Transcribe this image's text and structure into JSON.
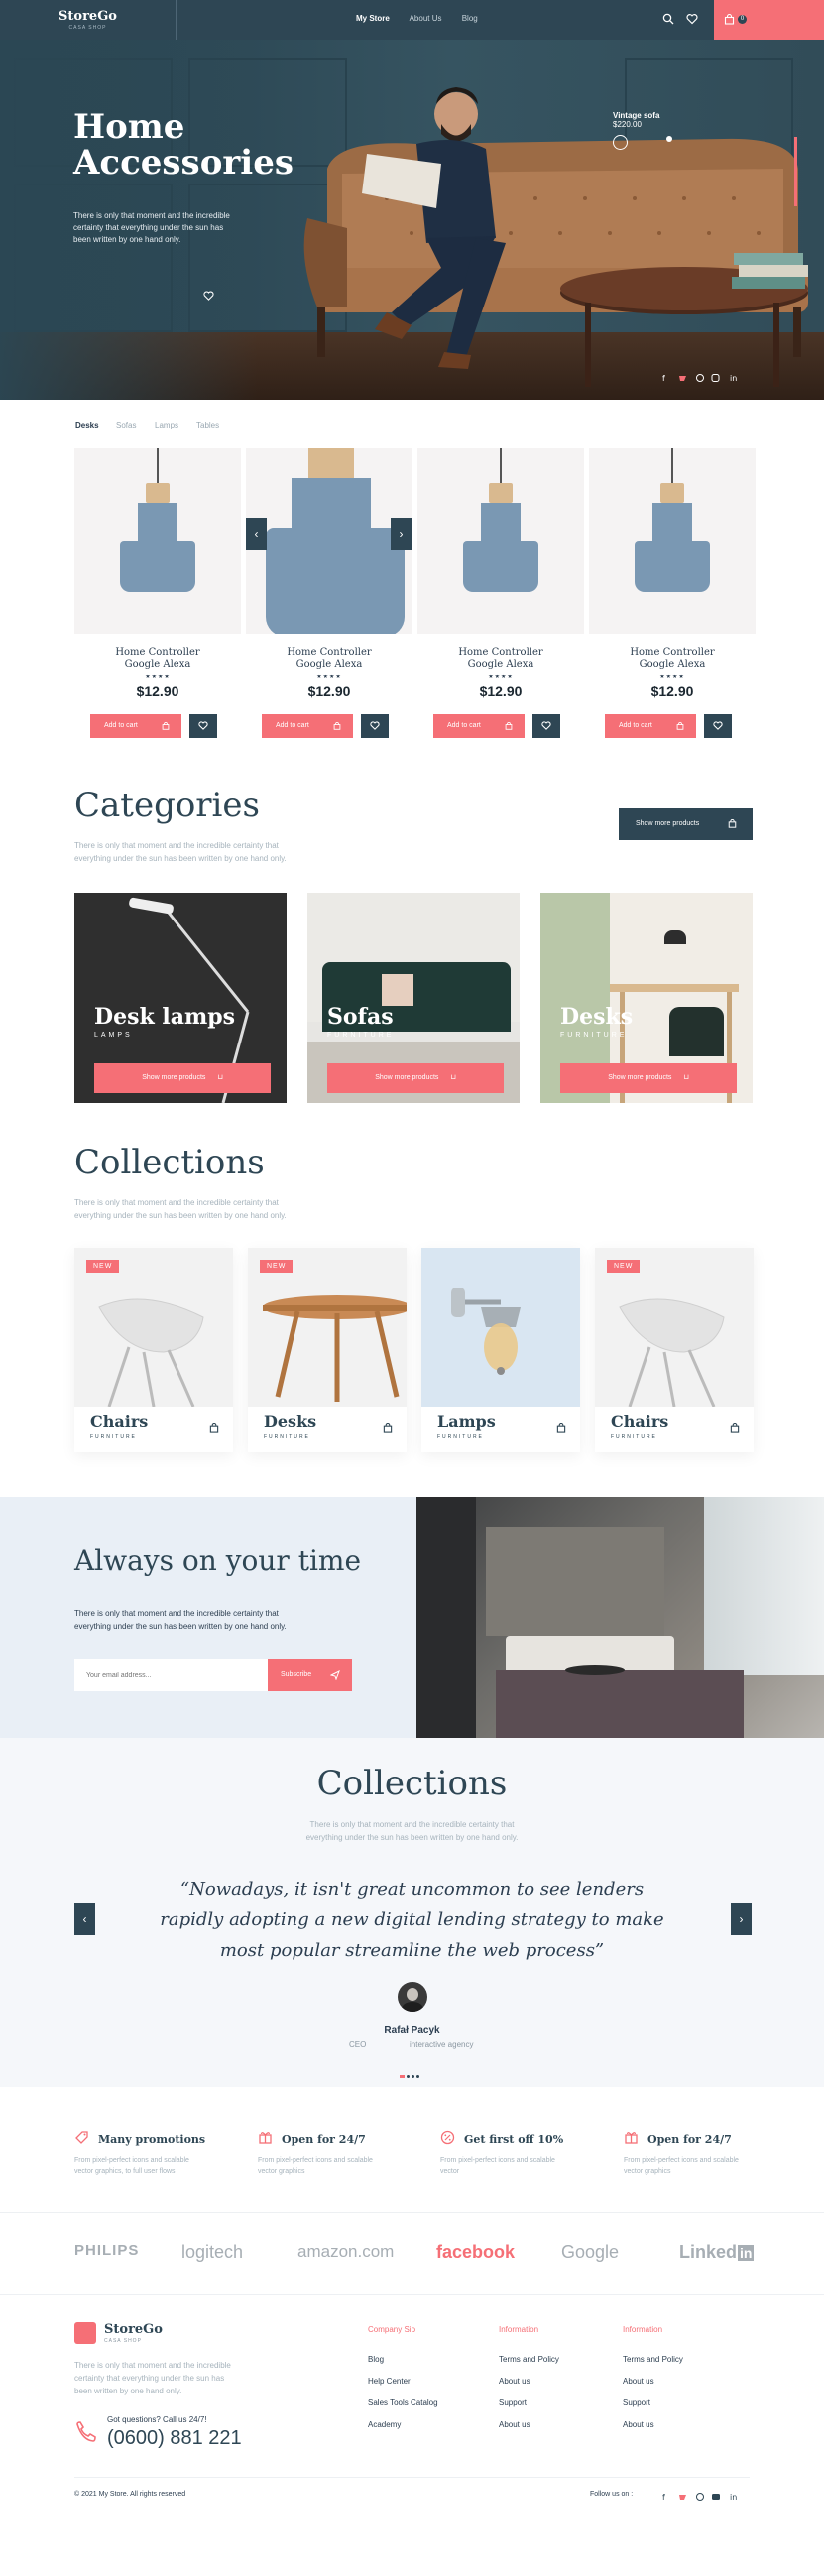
{
  "header": {
    "logo_name": "StoreGo",
    "logo_sub": "CASA SHOP",
    "nav": [
      "My Store",
      "About Us",
      "Blog"
    ],
    "cart_count": "0"
  },
  "hero": {
    "title_line1": "Home",
    "title_line2": "Accessories",
    "description_line1": "There is only that moment and the incredible",
    "description_line2": "certainty that everything under the sun has",
    "description_line3": "been written by one hand only.",
    "product_name": "Vintage sofa",
    "product_price": "$220.00"
  },
  "product_tabs": [
    "Desks",
    "Sofas",
    "Lamps",
    "Tables"
  ],
  "products": [
    {
      "name_line1": "Home Controller",
      "name_line2": "Google Alexa",
      "stars": "★★★★",
      "price": "$12.90",
      "add_label": "Add to cart"
    },
    {
      "name_line1": "Home Controller",
      "name_line2": "Google Alexa",
      "stars": "★★★★",
      "price": "$12.90",
      "add_label": "Add to cart"
    },
    {
      "name_line1": "Home Controller",
      "name_line2": "Google Alexa",
      "stars": "★★★★",
      "price": "$12.90",
      "add_label": "Add to cart"
    },
    {
      "name_line1": "Home Controller",
      "name_line2": "Google Alexa",
      "stars": "★★★★",
      "price": "$12.90",
      "add_label": "Add to cart"
    }
  ],
  "categories": {
    "title": "Categories",
    "desc_line1": "There is only that moment and the incredible certainty that",
    "desc_line2": "everything under the sun has been written by one hand only.",
    "more_label": "Show more products",
    "items": [
      {
        "title": "Desk lamps",
        "sub": "LAMPS",
        "button": "Show more products"
      },
      {
        "title": "Sofas",
        "sub": "FURNITURE",
        "button": "Show more products"
      },
      {
        "title": "Desks",
        "sub": "FURNITURE",
        "button": "Show more products"
      }
    ]
  },
  "collections": {
    "title": "Collections",
    "desc_line1": "There is only that moment and the incredible certainty that",
    "desc_line2": "everything under the sun has been written by one hand only.",
    "items": [
      {
        "badge": "NEW",
        "name": "Chairs",
        "sub": "FURNITURE"
      },
      {
        "badge": "NEW",
        "name": "Desks",
        "sub": "FURNITURE"
      },
      {
        "badge": "",
        "name": "Lamps",
        "sub": "FURNITURE"
      },
      {
        "badge": "NEW",
        "name": "Chairs",
        "sub": "FURNITURE"
      }
    ]
  },
  "newsletter": {
    "title": "Always on your time",
    "desc_line1": "There is only that moment and the incredible certainty that",
    "desc_line2": "everything under the sun has been written by one hand only.",
    "email_placeholder": "Your email address...",
    "subscribe_label": "Subscribe"
  },
  "testimonials": {
    "title": "Collections",
    "desc_line1": "There is only that moment and the incredible certainty that",
    "desc_line2": "everything under the sun has been written by one hand only.",
    "quote_line1": "“Nowadays, it isn't great uncommon to see lenders",
    "quote_line2": "rapidly adopting a new digital lending strategy to make",
    "quote_line3": "most  popular streamline the web process”",
    "author": "Rafał Pacyk",
    "role": "CEO",
    "company": "interactive agency"
  },
  "features": [
    {
      "title": "Many promotions",
      "desc_line1": "From pixel-perfect icons and scalable",
      "desc_line2": "vector graphics, to full user flows"
    },
    {
      "title": "Open for 24/7",
      "desc_line1": "From pixel-perfect icons and scalable",
      "desc_line2": "vector graphics"
    },
    {
      "title": "Get first off 10%",
      "desc_line1": "From pixel-perfect icons and scalable",
      "desc_line2": "vector"
    },
    {
      "title": "Open for 24/7",
      "desc_line1": "From pixel-perfect icons and scalable",
      "desc_line2": "vector graphics"
    }
  ],
  "brands": [
    "PHILIPS",
    "logitech",
    "amazon.com",
    "facebook",
    "Google",
    "Linked"
  ],
  "brand_suffix": "in",
  "footer": {
    "logo_name": "StoreGo",
    "logo_sub": "CASA SHOP",
    "desc_line1": "There is only that moment and the incredible",
    "desc_line2": "certainty that everything under the sun has",
    "desc_line3": "been written by one hand only.",
    "question": "Got questions? Call us 24/7!",
    "phone": "(0600) 881 221",
    "col1_title": "Company Sio",
    "col1": [
      "Blog",
      "Help Center",
      "Sales Tools Catalog",
      "Academy"
    ],
    "col2_title": "Information",
    "col2": [
      "Terms and Policy",
      "About us",
      "Support",
      "About us"
    ],
    "col3_title": "Information",
    "col3": [
      "Terms and Policy",
      "About us",
      "Support",
      "About us"
    ],
    "copyright": "© 2021 My Store. All rights reserved",
    "follow": "Follow us on :"
  },
  "colors": {
    "accent": "#f56f76",
    "primary": "#2e4654",
    "light_bg": "#e9eff6"
  }
}
